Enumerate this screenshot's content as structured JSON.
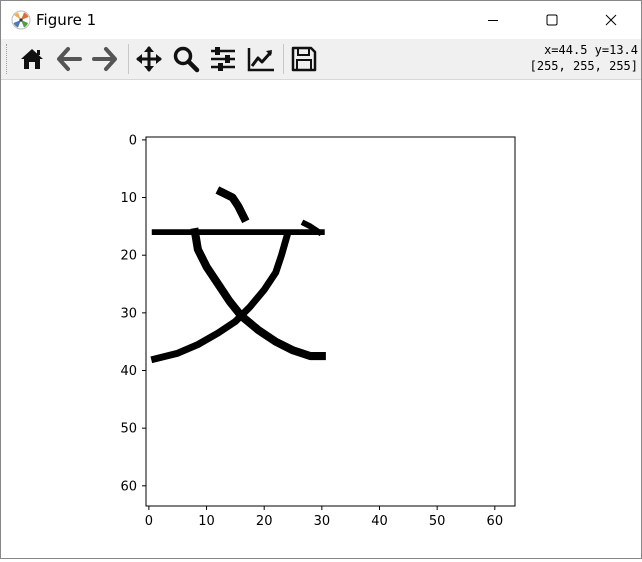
{
  "window": {
    "title": "Figure 1",
    "app_icon": "matplotlib-icon",
    "controls": {
      "minimize": "minimize-icon",
      "maximize": "maximize-icon",
      "close": "close-icon"
    }
  },
  "toolbar": {
    "buttons": [
      {
        "name": "home",
        "icon": "home-icon"
      },
      {
        "name": "back",
        "icon": "arrow-left-icon"
      },
      {
        "name": "forward",
        "icon": "arrow-right-icon"
      },
      {
        "name": "pan",
        "icon": "move-icon"
      },
      {
        "name": "zoom",
        "icon": "magnifier-icon"
      },
      {
        "name": "subplots",
        "icon": "sliders-icon"
      },
      {
        "name": "customize",
        "icon": "line-chart-icon"
      },
      {
        "name": "save",
        "icon": "floppy-disk-icon"
      }
    ],
    "coords_line1": "x=44.5 y=13.4",
    "coords_line2": "[255, 255, 255]"
  },
  "chart_data": {
    "type": "heatmap",
    "colormap": "gray_r",
    "image_size": [
      64,
      64
    ],
    "xlim": [
      -0.5,
      63.5
    ],
    "ylim": [
      63.5,
      -0.5
    ],
    "x_ticks": [
      0,
      10,
      20,
      30,
      40,
      50,
      60
    ],
    "y_ticks": [
      0,
      10,
      20,
      30,
      40,
      50,
      60
    ],
    "x_tick_labels": [
      "0",
      "10",
      "20",
      "30",
      "40",
      "50",
      "60"
    ],
    "y_tick_labels": [
      "0",
      "10",
      "20",
      "30",
      "40",
      "50",
      "60"
    ],
    "title": "",
    "xlabel": "",
    "ylabel": "",
    "strokes": [
      {
        "name": "top-dot",
        "points": [
          [
            12.5,
            9
          ],
          [
            14.5,
            10
          ],
          [
            15.5,
            11.5
          ],
          [
            16.5,
            13.5
          ]
        ],
        "width": 1.4
      },
      {
        "name": "horizontal-bar",
        "points": [
          [
            1,
            16
          ],
          [
            30,
            16
          ]
        ],
        "width": 1.0
      },
      {
        "name": "right-hook",
        "points": [
          [
            27,
            14.5
          ],
          [
            28,
            15
          ],
          [
            29.5,
            16
          ]
        ],
        "width": 1.0
      },
      {
        "name": "left-falling",
        "points": [
          [
            8,
            16
          ],
          [
            8.5,
            19
          ],
          [
            10,
            22
          ],
          [
            12,
            25
          ],
          [
            14,
            28
          ],
          [
            16,
            30.5
          ],
          [
            19,
            33
          ],
          [
            22,
            35
          ],
          [
            25,
            36.5
          ],
          [
            28,
            37.5
          ],
          [
            30,
            37.5
          ]
        ],
        "width": 1.4
      },
      {
        "name": "right-falling",
        "points": [
          [
            24,
            16.5
          ],
          [
            23,
            20
          ],
          [
            22,
            23
          ],
          [
            20,
            26
          ],
          [
            17.5,
            29
          ],
          [
            15,
            31.5
          ],
          [
            12,
            33.5
          ],
          [
            8.5,
            35.5
          ],
          [
            5,
            37
          ],
          [
            1,
            38
          ]
        ],
        "width": 1.2
      }
    ]
  }
}
